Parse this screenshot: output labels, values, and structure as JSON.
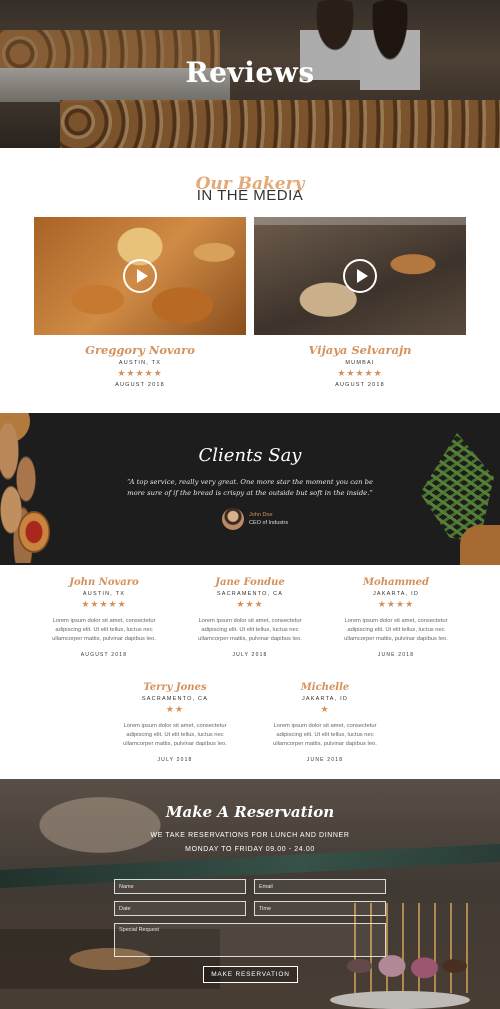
{
  "hero": {
    "title": "Reviews"
  },
  "media": {
    "script_title": "Our Bakery",
    "subtitle": "IN THE MEDIA",
    "cards": [
      {
        "name": "Greggory Novaro",
        "location": "AUSTIN, TX",
        "stars": "★★★★★",
        "rating": 5,
        "date": "AUGUST 2018"
      },
      {
        "name": "Vijaya Selvarajn",
        "location": "MUMBAI",
        "stars": "★★★★★",
        "rating": 5,
        "date": "AUGUST 2018"
      }
    ]
  },
  "clients": {
    "title": "Clients Say",
    "quote": "“A top service, really very great. One more star the moment you can be more sure of if the bread is crispy at the outside but soft in the inside.”",
    "author_name": "John Doe",
    "author_role": "CEO of Industrs"
  },
  "testimonials": [
    {
      "name": "John Novaro",
      "location": "AUSTIN, TX",
      "stars": "★★★★★",
      "rating": 5,
      "body": "Lorem ipsum dolor sit amet, consectetur adipiscing elit. Ut elit tellus, luctus nec ullamcorper mattis, pulvinar dapibus leo.",
      "date": "AUGUST 2018"
    },
    {
      "name": "Jane Fondue",
      "location": "SACRAMENTO, CA",
      "stars": "★★★",
      "rating": 3,
      "body": "Lorem ipsum dolor sit amet, consectetur adipiscing elit. Ut elit tellus, luctus nec ullamcorper mattis, pulvinar dapibus leo.",
      "date": "JULY 2018"
    },
    {
      "name": "Mohammed",
      "location": "JAKARTA, ID",
      "stars": "★★★★",
      "rating": 4,
      "body": "Lorem ipsum dolor sit amet, consectetur adipiscing elit. Ut elit tellus, luctus nec ullamcorper mattis, pulvinar dapibus leo.",
      "date": "JUNE 2018"
    },
    {
      "name": "Terry Jones",
      "location": "SACRAMENTO, CA",
      "stars": "★★",
      "rating": 2,
      "body": "Lorem ipsum dolor sit amet, consectetur adipiscing elit. Ut elit tellus, luctus nec ullamcorper mattis, pulvinar dapibus leo.",
      "date": "JULY 2018"
    },
    {
      "name": "Michelle",
      "location": "JAKARTA, ID",
      "stars": "★",
      "rating": 1,
      "body": "Lorem ipsum dolor sit amet, consectetur adipiscing elit. Ut elit tellus, luctus nec ullamcorper mattis, pulvinar dapibus leo.",
      "date": "JUNE 2018"
    }
  ],
  "reservation": {
    "title": "Make A Reservation",
    "line1": "WE TAKE RESERVATIONS FOR LUNCH AND DINNER",
    "line2": "MONDAY TO FRIDAY 09.00 - 24.00",
    "fields": {
      "name_placeholder": "Name",
      "email_placeholder": "Email",
      "date_placeholder": "Date",
      "time_placeholder": "Time",
      "request_placeholder": "Special Request"
    },
    "button_label": "MAKE RESERVATION"
  },
  "colors": {
    "accent": "#d4915c",
    "dark": "#1d1d1d"
  }
}
